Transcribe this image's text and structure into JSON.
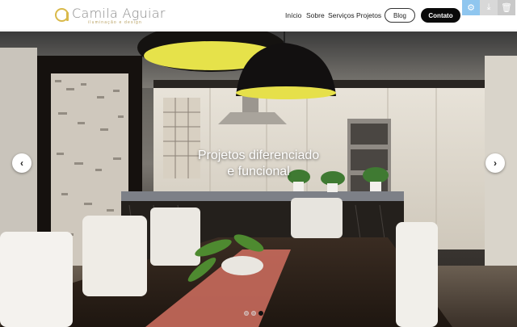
{
  "header": {
    "logo": {
      "name": "Camila Aguiar",
      "tagline": "iluminação e design"
    },
    "nav": [
      {
        "label": "Início"
      },
      {
        "label": "Sobre"
      },
      {
        "label": "Serviços"
      },
      {
        "label": "Projetos"
      }
    ],
    "blog_label": "Blog",
    "contact_label": "Contato"
  },
  "toolbar": {
    "icons": [
      "gear-icon",
      "download-icon",
      "trash-icon"
    ],
    "accent": "#8fc6ef"
  },
  "hero": {
    "caption_line1": "Projetos diferenciado",
    "caption_line2": "e funcional",
    "prev_glyph": "‹",
    "next_glyph": "›",
    "slides_total": 3,
    "active_slide": 3
  },
  "colors": {
    "brand_gold": "#d9b94a",
    "contact_button": "#0a0a0a"
  }
}
